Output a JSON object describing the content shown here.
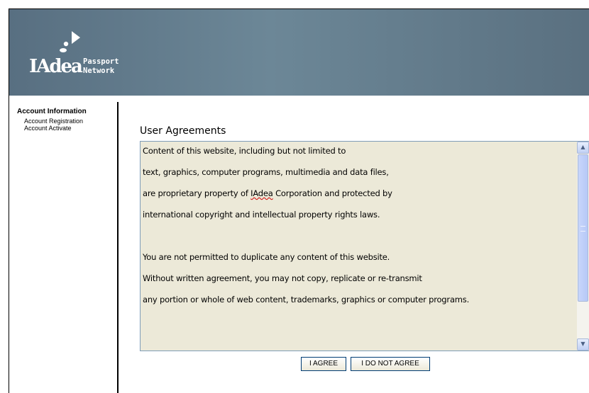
{
  "header": {
    "logo": {
      "brand_text": "IAdea",
      "tagline_line1": "Passport",
      "tagline_line2": "Network",
      "icon": "arrow-dots-logo-icon",
      "color": "#ffffff"
    },
    "background_colors": [
      "#586f81",
      "#6c8797",
      "#5a7080"
    ]
  },
  "sidebar": {
    "title": "Account Information",
    "items": [
      {
        "label": "Account Registration"
      },
      {
        "label": "Account Activate"
      }
    ]
  },
  "main": {
    "section_title": "User Agreements",
    "agreement_lines": [
      "Content of this website, including but not limited to",
      "text, graphics, computer programs, multimedia and data files,",
      "are proprietary property of IAdea Corporation and protected by",
      "international copyright and intellectual property rights laws.",
      "",
      "You are not permitted to duplicate any content of this website.",
      "Without written agreement, you may not copy, replicate or re-transmit",
      "any portion or whole of web content, trademarks, graphics or computer programs."
    ],
    "line3_parts": {
      "before": "are proprietary property of ",
      "misspelled": "IAdea",
      "after": " Corporation and protected by"
    },
    "scrollbar_icons": {
      "up": "scroll-up-arrow-icon",
      "down": "scroll-down-arrow-icon"
    },
    "buttons": {
      "agree_label": "I AGREE",
      "disagree_label": "I DO NOT AGREE"
    }
  }
}
